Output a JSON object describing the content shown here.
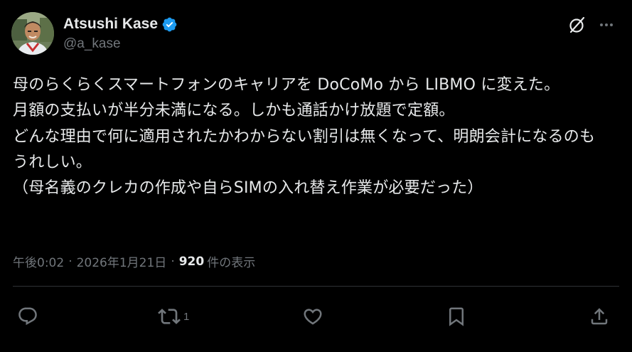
{
  "author": {
    "display_name": "Atsushi Kase",
    "handle": "@a_kase",
    "verified": true,
    "avatar_icon": "user-avatar-photo"
  },
  "header_actions": {
    "grok_icon": "grok-icon",
    "more_icon": "more-dots-icon"
  },
  "tweet": {
    "text": "母のらくらくスマートフォンのキャリアを DoCoMo から LIBMO に変えた。\n月額の支払いが半分未満になる。しかも通話かけ放題で定額。\nどんな理由で何に適用されたかわからない割引は無くなって、明朗会計になるのもうれしい。\n（母名義のクレカの作成や自らSIMの入れ替え作業が必要だった）"
  },
  "meta": {
    "time": "午後0:02",
    "separator": "·",
    "date": "2026年1月21日",
    "views_count": "920",
    "views_label": "件の表示"
  },
  "actions": {
    "reply_icon": "reply-icon",
    "retweet_icon": "retweet-icon",
    "retweet_count": "1",
    "like_icon": "heart-icon",
    "bookmark_icon": "bookmark-icon",
    "share_icon": "share-icon"
  },
  "colors": {
    "background": "#000000",
    "text_primary": "#e7e9ea",
    "text_secondary": "#71767b",
    "verified_blue": "#1d9bf0",
    "divider": "#2f3336"
  }
}
